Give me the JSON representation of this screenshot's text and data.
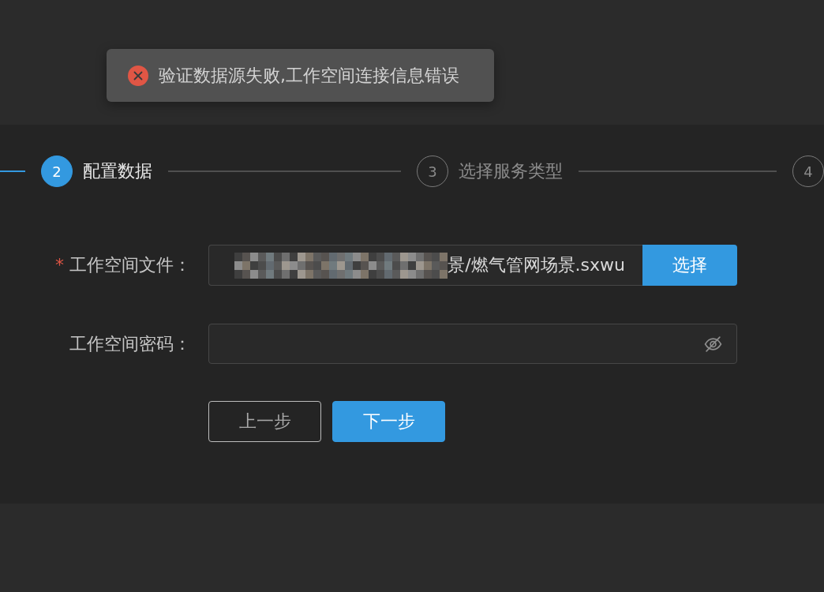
{
  "toast": {
    "kind": "error",
    "message": "验证数据源失败,工作空间连接信息错误"
  },
  "steps": {
    "leading_line": {
      "done": true
    },
    "items": [
      {
        "number": "2",
        "label": "配置数据",
        "selected": true,
        "done": false
      },
      {
        "number": "3",
        "label": "选择服务类型",
        "selected": false,
        "done": false
      },
      {
        "number": "4",
        "selected": false,
        "done": false
      }
    ]
  },
  "form": {
    "fields": [
      {
        "kind": "file",
        "required_mark": "*",
        "label": "工作空间文件：",
        "value": "景/燃气管网场景.sxwu",
        "redacted": true,
        "button": "选择"
      },
      {
        "kind": "password",
        "label": "工作空间密码："
      }
    ]
  },
  "actions": [
    {
      "label": "上一步",
      "primary": false
    },
    {
      "label": "下一步",
      "primary": true
    }
  ]
}
